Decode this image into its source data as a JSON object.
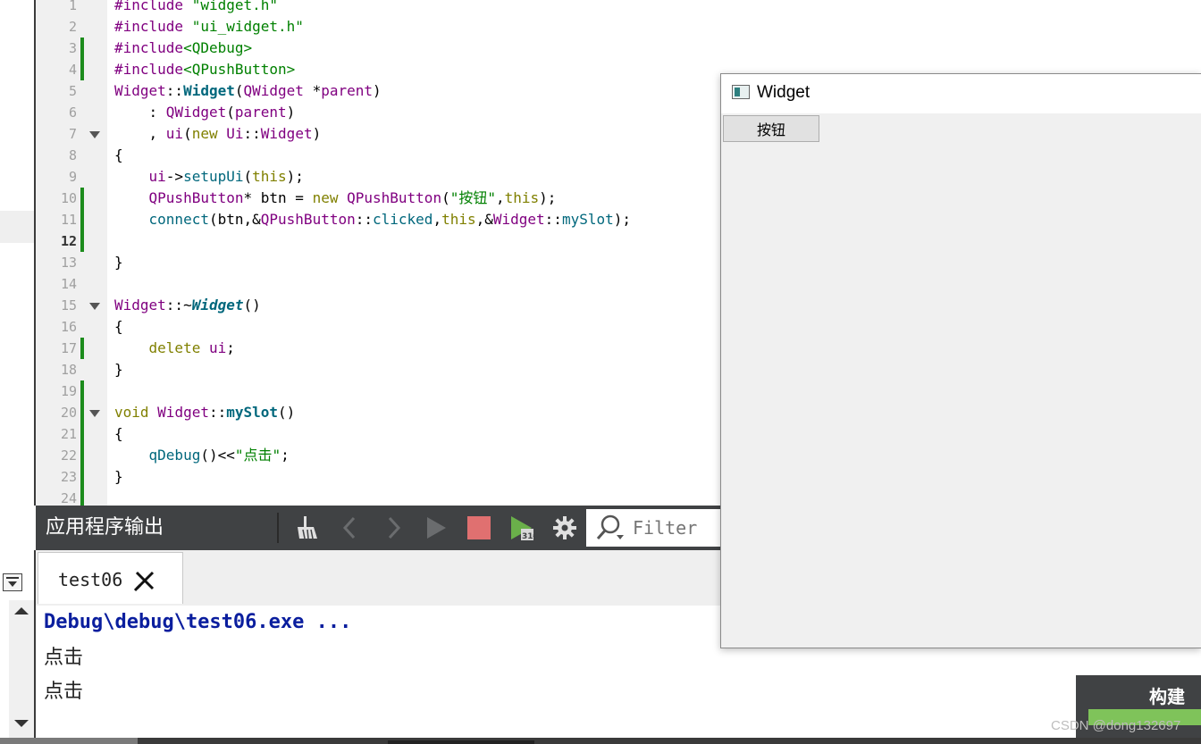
{
  "editor": {
    "lines": [
      {
        "num": "1",
        "changed": false,
        "fold": false,
        "html": "<span class=\"p\">#include</span> <span class=\"g\">\"widget.h\"</span>"
      },
      {
        "num": "2",
        "changed": false,
        "fold": false,
        "html": "<span class=\"p\">#include</span> <span class=\"g\">\"ui_widget.h\"</span>"
      },
      {
        "num": "3",
        "changed": true,
        "fold": false,
        "html": "<span class=\"p\">#include</span><span class=\"g\">&lt;QDebug&gt;</span>"
      },
      {
        "num": "4",
        "changed": true,
        "fold": false,
        "html": "<span class=\"p\">#include</span><span class=\"g\">&lt;QPushButton&gt;</span>"
      },
      {
        "num": "5",
        "changed": false,
        "fold": false,
        "html": "<span class=\"t\">Widget</span>::<span class=\"b\">Widget</span>(<span class=\"t\">QWidget</span> *<span class=\"t\">parent</span>)"
      },
      {
        "num": "6",
        "changed": false,
        "fold": false,
        "html": "    : <span class=\"t\">QWidget</span>(<span class=\"t\">parent</span>)"
      },
      {
        "num": "7",
        "changed": false,
        "fold": true,
        "html": "    , <span class=\"t\">ui</span>(<span class=\"o\">new</span> <span class=\"t\">Ui</span>::<span class=\"t\">Widget</span>)"
      },
      {
        "num": "8",
        "changed": false,
        "fold": false,
        "html": "{"
      },
      {
        "num": "9",
        "changed": false,
        "fold": false,
        "html": "    <span class=\"t\">ui</span>-&gt;<span class=\"f\">setupUi</span>(<span class=\"o\">this</span>);"
      },
      {
        "num": "10",
        "changed": true,
        "fold": false,
        "html": "    <span class=\"t\">QPushButton</span>* btn = <span class=\"o\">new</span> <span class=\"t\">QPushButton</span>(<span class=\"g\">\"按钮\"</span>,<span class=\"o\">this</span>);"
      },
      {
        "num": "11",
        "changed": true,
        "fold": false,
        "html": "    <span class=\"f\">connect</span>(btn,&amp;<span class=\"t\">QPushButton</span>::<span class=\"f\">clicked</span>,<span class=\"o\">this</span>,&amp;<span class=\"t\">Widget</span>::<span class=\"f\">mySlot</span>);"
      },
      {
        "num": "12",
        "changed": true,
        "fold": false,
        "current": true,
        "html": ""
      },
      {
        "num": "13",
        "changed": false,
        "fold": false,
        "html": "}"
      },
      {
        "num": "14",
        "changed": false,
        "fold": false,
        "html": ""
      },
      {
        "num": "15",
        "changed": false,
        "fold": true,
        "html": "<span class=\"t\">Widget</span>::~<span class=\"bi\">Widget</span>()"
      },
      {
        "num": "16",
        "changed": false,
        "fold": false,
        "html": "{"
      },
      {
        "num": "17",
        "changed": true,
        "fold": false,
        "html": "    <span class=\"o\">delete</span> <span class=\"t\">ui</span>;"
      },
      {
        "num": "18",
        "changed": false,
        "fold": false,
        "html": "}"
      },
      {
        "num": "19",
        "changed": true,
        "fold": false,
        "html": ""
      },
      {
        "num": "20",
        "changed": true,
        "fold": true,
        "html": "<span class=\"o\">void</span> <span class=\"t\">Widget</span>::<span class=\"b\">mySlot</span>()"
      },
      {
        "num": "21",
        "changed": true,
        "fold": false,
        "html": "{"
      },
      {
        "num": "22",
        "changed": true,
        "fold": false,
        "html": "    <span class=\"f\">qDebug</span>()&lt;&lt;<span class=\"g\">\"点击\"</span>;"
      },
      {
        "num": "23",
        "changed": true,
        "fold": false,
        "html": "}"
      },
      {
        "num": "24",
        "changed": true,
        "fold": false,
        "html": ""
      }
    ]
  },
  "output_panel": {
    "title": "应用程序输出",
    "filter_placeholder": "Filter",
    "tab_label": "test06",
    "lines": [
      "Debug\\debug\\test06.exe ...",
      "点击",
      "点击"
    ]
  },
  "widget_window": {
    "title": "Widget",
    "button_label": "按钮"
  },
  "build_panel": {
    "label": "构建",
    "progress_fraction": 1.0,
    "progress_color": "#7fc35a"
  },
  "watermark": "CSDN @dong132697",
  "colors": {
    "change_marker": "#1c8c1c",
    "stop_button": "#e07070",
    "run_button": "#6a9a5a"
  }
}
